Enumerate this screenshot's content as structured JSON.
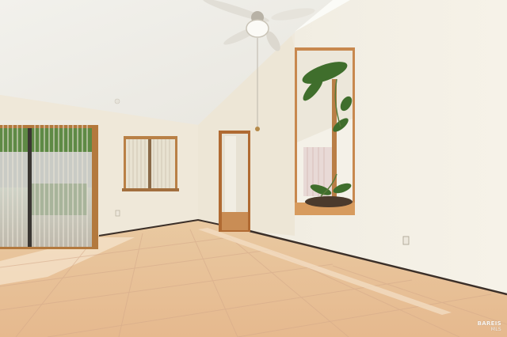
{
  "watermark": {
    "brand": "BAREIS",
    "suffix": "MLS"
  }
}
